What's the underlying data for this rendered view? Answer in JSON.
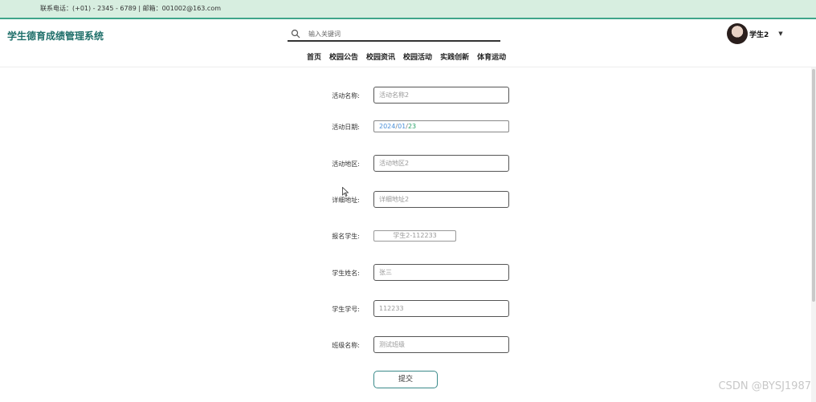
{
  "topbar": {
    "contact": "联系电话：(+01) - 2345 - 6789 | 邮箱：001002@163.com"
  },
  "header": {
    "brand": "学生德育成绩管理系统",
    "search": {
      "placeholder": "输入关键词"
    },
    "user": {
      "name": "学生2"
    },
    "nav": [
      "首页",
      "校园公告",
      "校园资讯",
      "校园活动",
      "实践创新",
      "体育运动"
    ]
  },
  "form": {
    "activity_name": {
      "label": "活动名称:",
      "placeholder": "活动名称2"
    },
    "activity_date": {
      "label": "活动日期:",
      "year": "2024",
      "month": "01",
      "day": "23"
    },
    "activity_area": {
      "label": "活动地区:",
      "placeholder": "活动地区2"
    },
    "address": {
      "label": "详细地址:",
      "placeholder": "详细地址2"
    },
    "student_select": {
      "label": "报名学生:",
      "value": "学生2-112233"
    },
    "student_name": {
      "label": "学生姓名:",
      "placeholder": "张三"
    },
    "student_id": {
      "label": "学生学号:",
      "placeholder": "112233"
    },
    "class_name": {
      "label": "班级名称:",
      "placeholder": "测试班级"
    },
    "submit_label": "提交"
  },
  "watermark": "CSDN @BYSJ1987",
  "colors": {
    "topbar_bg": "#d7eee0",
    "accent": "#3fa58a",
    "brand": "#1f6f6a"
  }
}
